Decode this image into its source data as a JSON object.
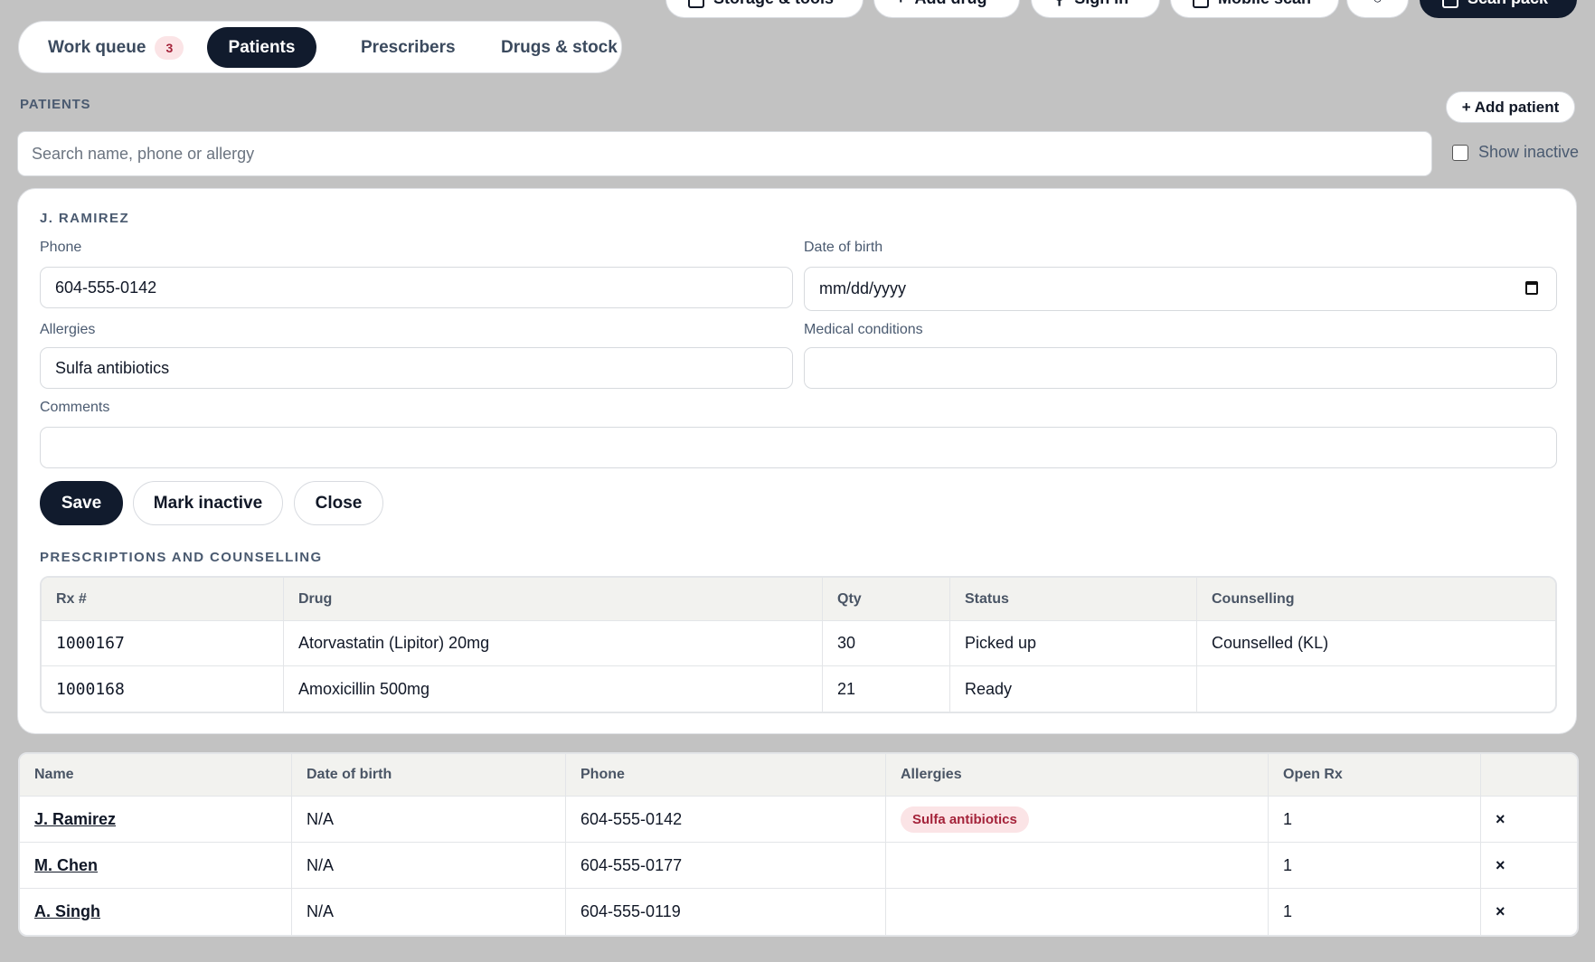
{
  "toolbar": {
    "buttons": [
      {
        "label": "Storage & tools"
      },
      {
        "label": "Add drug"
      },
      {
        "label": "Sign in"
      },
      {
        "label": "Mobile scan"
      },
      {
        "label": ""
      },
      {
        "label": "Scan pack"
      }
    ]
  },
  "tabs": [
    {
      "label": "Work queue",
      "count": "3"
    },
    {
      "label": "Patients"
    },
    {
      "label": "Prescribers"
    },
    {
      "label": "Drugs & stock"
    }
  ],
  "patients_section": {
    "title": "PATIENTS",
    "add_label": "+ Add patient",
    "search_placeholder": "Search name, phone or allergy",
    "show_inactive_label": "Show inactive"
  },
  "patient_detail": {
    "name": "J. RAMIREZ",
    "phone_label": "Phone",
    "phone": "604-555-0142",
    "dob_label": "Date of birth",
    "dob_placeholder": "mm/dd/yyyy",
    "allergies_label": "Allergies",
    "allergies": "Sulfa antibiotics",
    "conditions_label": "Medical conditions",
    "conditions": "",
    "comments_label": "Comments",
    "comments": "",
    "save_label": "Save",
    "inactive_label": "Mark inactive",
    "close_label": "Close",
    "rx_title": "PRESCRIPTIONS AND COUNSELLING",
    "rx_headers": [
      "Rx #",
      "Drug",
      "Qty",
      "Status",
      "Counselling"
    ],
    "rx_rows": [
      [
        "1000167",
        "Atorvastatin (Lipitor) 20mg",
        "30",
        "Picked up",
        "Counselled (KL)"
      ],
      [
        "1000168",
        "Amoxicillin 500mg",
        "21",
        "Ready",
        ""
      ]
    ]
  },
  "patient_table": {
    "headers": [
      "Name",
      "Date of birth",
      "Phone",
      "Allergies",
      "Open Rx",
      ""
    ],
    "rows": [
      {
        "name": "J. Ramirez",
        "dob": "N/A",
        "phone": "604-555-0142",
        "allergy": "Sulfa antibiotics",
        "open_rx": "1",
        "remove": "×"
      },
      {
        "name": "M. Chen",
        "dob": "N/A",
        "phone": "604-555-0177",
        "allergy": "",
        "open_rx": "1",
        "remove": "×"
      },
      {
        "name": "A. Singh",
        "dob": "N/A",
        "phone": "604-555-0119",
        "allergy": "",
        "open_rx": "1",
        "remove": "×"
      }
    ]
  },
  "colors": {
    "background": "#c2c2c2",
    "primary": "#111b2d",
    "allergy_bg": "#fbe4e6",
    "allergy_fg": "#a4233a"
  }
}
